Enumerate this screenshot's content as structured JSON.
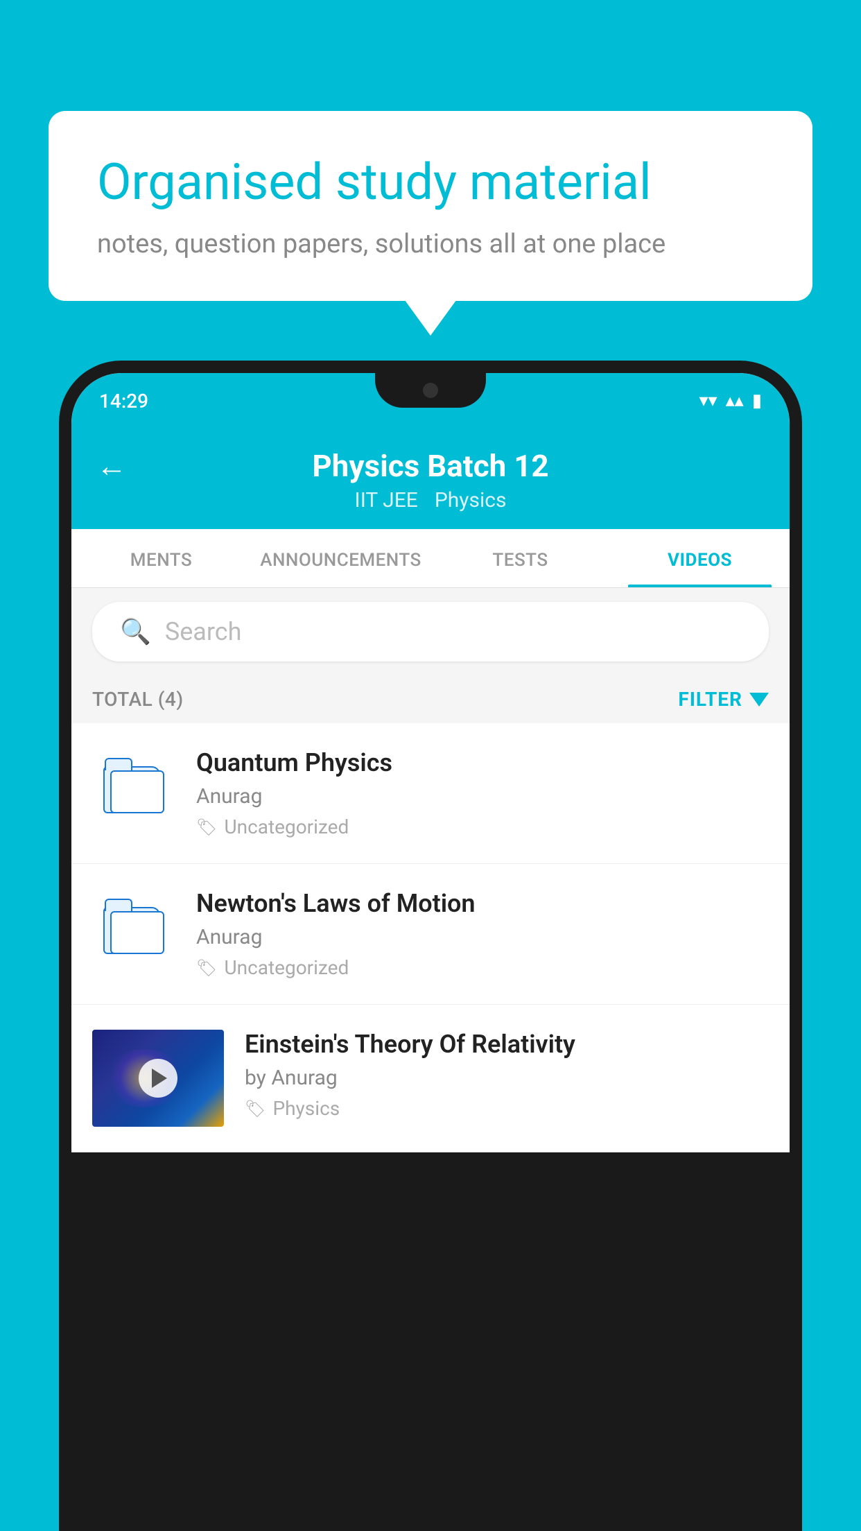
{
  "background_color": "#00bcd4",
  "bubble": {
    "title": "Organised study material",
    "subtitle": "notes, question papers, solutions all at one place"
  },
  "phone": {
    "status_bar": {
      "time": "14:29",
      "wifi": "▾",
      "signal": "▴",
      "battery": "▮"
    },
    "header": {
      "back_label": "←",
      "title": "Physics Batch 12",
      "subtitle1": "IIT JEE",
      "subtitle2": "Physics"
    },
    "tabs": [
      {
        "label": "MENTS",
        "active": false
      },
      {
        "label": "ANNOUNCEMENTS",
        "active": false
      },
      {
        "label": "TESTS",
        "active": false
      },
      {
        "label": "VIDEOS",
        "active": true
      }
    ],
    "search": {
      "placeholder": "Search"
    },
    "filter": {
      "total_label": "TOTAL (4)",
      "filter_label": "FILTER"
    },
    "videos": [
      {
        "id": 1,
        "title": "Quantum Physics",
        "author": "Anurag",
        "tag": "Uncategorized",
        "has_thumbnail": false
      },
      {
        "id": 2,
        "title": "Newton's Laws of Motion",
        "author": "Anurag",
        "tag": "Uncategorized",
        "has_thumbnail": false
      },
      {
        "id": 3,
        "title": "Einstein's Theory Of Relativity",
        "author": "by Anurag",
        "tag": "Physics",
        "has_thumbnail": true
      }
    ]
  }
}
